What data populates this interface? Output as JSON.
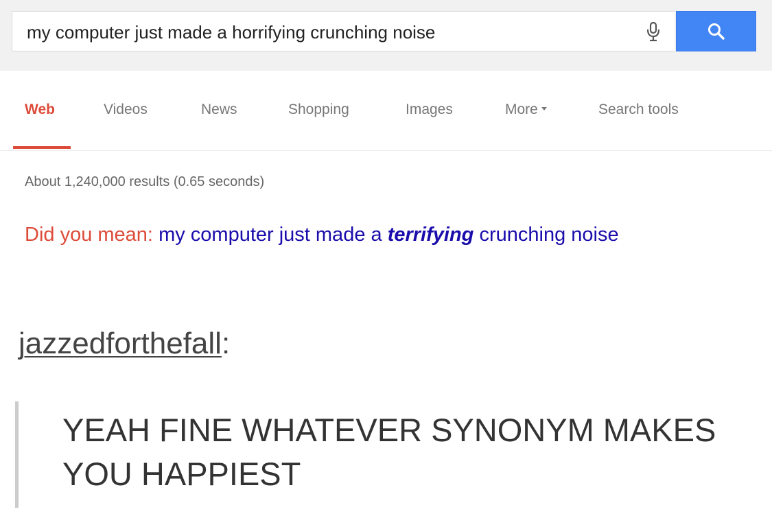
{
  "search": {
    "query": "my computer just made a horrifying crunching noise",
    "mic_icon": "microphone-icon",
    "search_icon": "magnifier-icon",
    "accent_color": "#4285f4"
  },
  "tabs": {
    "items": [
      {
        "label": "Web",
        "active": true
      },
      {
        "label": "Videos"
      },
      {
        "label": "News"
      },
      {
        "label": "Shopping"
      },
      {
        "label": "Images"
      },
      {
        "label": "More"
      },
      {
        "label": "Search tools"
      }
    ],
    "active_color": "#dd4b39"
  },
  "results": {
    "stats": "About 1,240,000 results (0.65 seconds)",
    "did_you_mean": {
      "label": "Did you mean:",
      "before": "my computer just made a",
      "emphasis": "terrifying",
      "after": "crunching noise"
    }
  },
  "tumblr": {
    "username": "jazzedforthefall",
    "colon": ":",
    "reply": "YEAH FINE WHATEVER SYNONYM MAKES YOU HAPPIEST"
  }
}
